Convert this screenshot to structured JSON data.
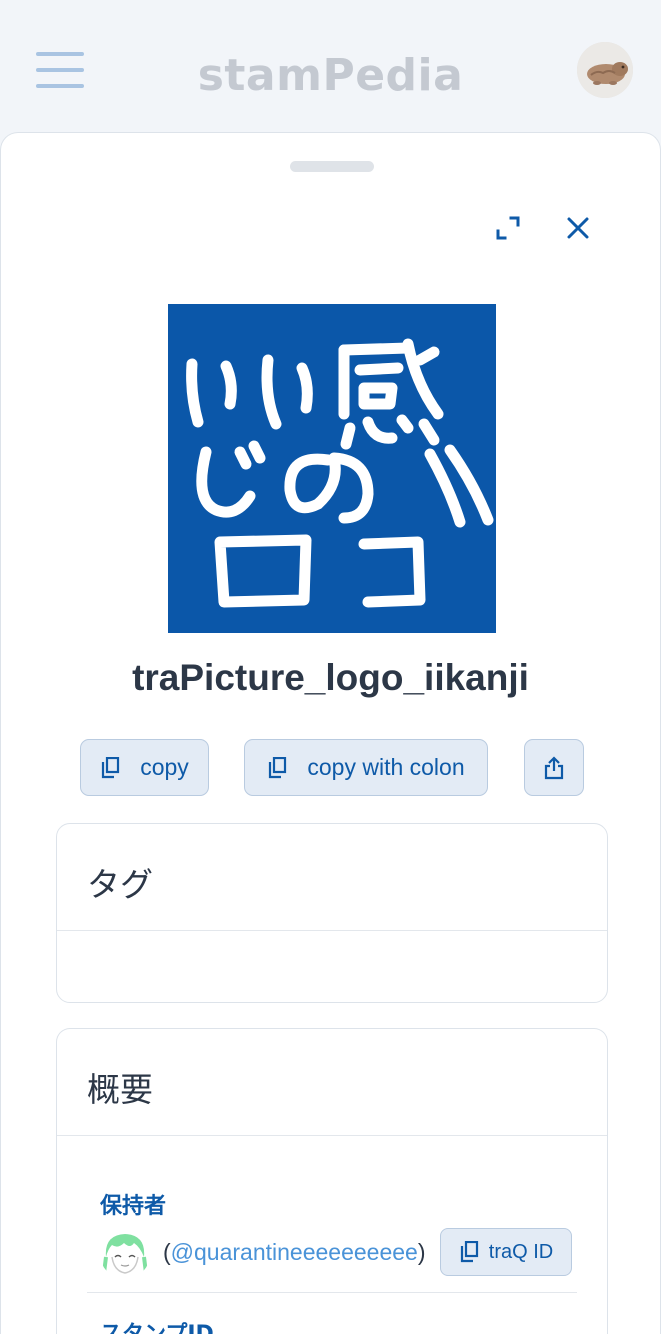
{
  "header": {
    "app_title": "stamPedia",
    "menu_icon": "hamburger-menu-icon",
    "avatar_icon": "user-avatar"
  },
  "sheet": {
    "expand_icon": "expand-icon",
    "close_icon": "close-icon"
  },
  "stamp": {
    "name": "traPicture_logo_iikanji",
    "image_background": "#0b57a9"
  },
  "actions": {
    "copy_label": "copy",
    "copy_with_colon_label": "copy with colon",
    "copy_icon": "copy-icon",
    "share_icon": "share-icon"
  },
  "tags": {
    "title": "タグ"
  },
  "summary": {
    "title": "概要",
    "owner_label": "保持者",
    "owner_handle_open": "(",
    "owner_handle": "@quarantineeeeeeeeee",
    "owner_handle_close": ")",
    "traq_id_button": "traQ ID",
    "stamp_id_label": "スタンプID"
  },
  "colors": {
    "accent": "#0e5aa8",
    "link": "#4a93d8",
    "button_bg": "#e3ebf5"
  }
}
